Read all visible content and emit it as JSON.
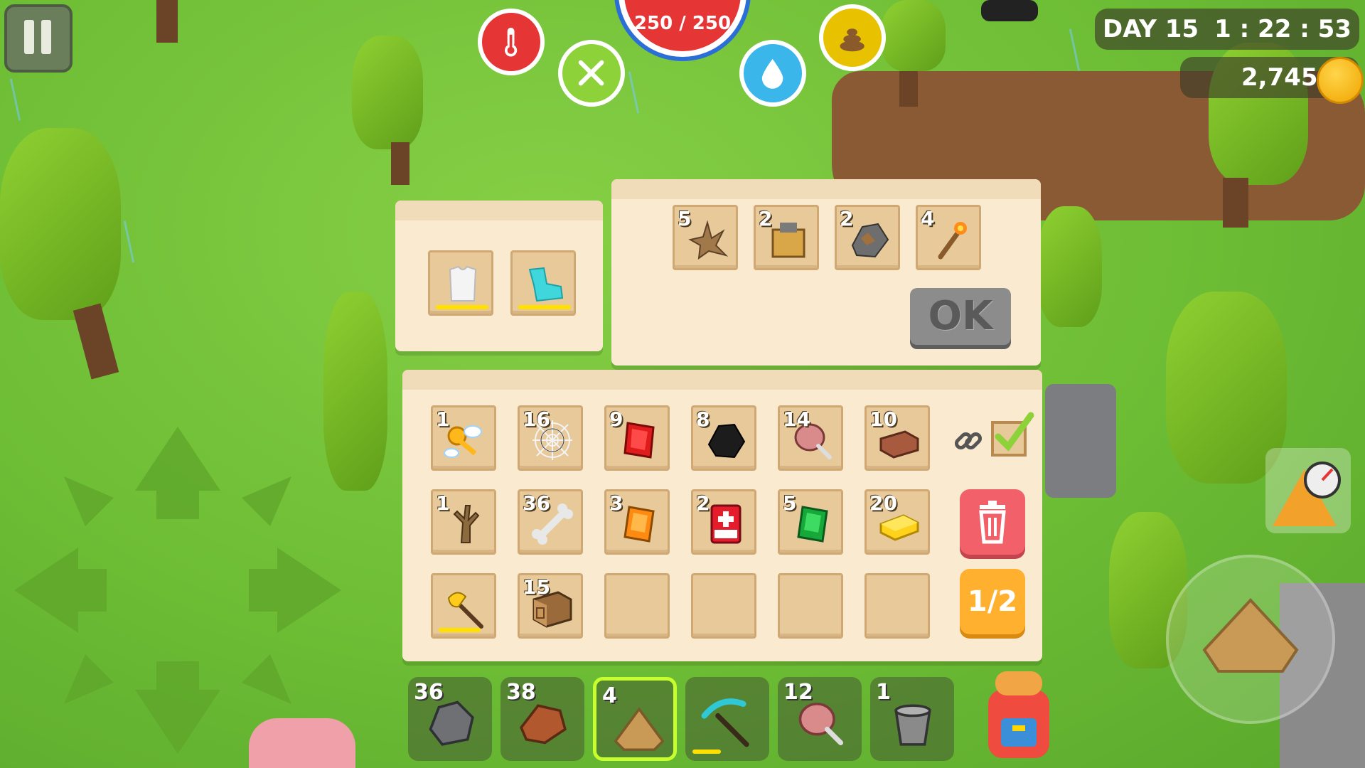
{
  "hud": {
    "health": "250 / 250",
    "day_label": "DAY 15",
    "clock": "1 : 22 : 53",
    "coins": "2,745",
    "stats": [
      "temperature-icon",
      "hunger-icon",
      "thirst-icon",
      "toilet-icon"
    ]
  },
  "equipment": {
    "slots": [
      {
        "icon": "shirt-icon",
        "durability": 0.85
      },
      {
        "icon": "boots-icon",
        "durability": 0.85
      }
    ]
  },
  "crafting": {
    "ingredients": [
      {
        "count": "5",
        "icon": "roots-icon"
      },
      {
        "count": "2",
        "icon": "furnace-crate-icon"
      },
      {
        "count": "2",
        "icon": "iron-ore-icon"
      },
      {
        "count": "4",
        "icon": "torch-icon"
      }
    ],
    "ok_label": "OK"
  },
  "inventory": {
    "page": "1/2",
    "rows": [
      [
        {
          "count": "1",
          "icon": "winged-key-icon"
        },
        {
          "count": "16",
          "icon": "spider-web-icon"
        },
        {
          "count": "9",
          "icon": "ruby-icon"
        },
        {
          "count": "8",
          "icon": "coal-icon"
        },
        {
          "count": "14",
          "icon": "meat-icon"
        },
        {
          "count": "10",
          "icon": "clay-brick-icon"
        }
      ],
      [
        {
          "count": "1",
          "icon": "dead-tree-icon"
        },
        {
          "count": "36",
          "icon": "bone-icon"
        },
        {
          "count": "3",
          "icon": "amber-icon"
        },
        {
          "count": "2",
          "icon": "medkit-icon"
        },
        {
          "count": "5",
          "icon": "emerald-icon"
        },
        {
          "count": "20",
          "icon": "gold-bar-icon"
        }
      ],
      [
        {
          "count": "",
          "icon": "axe-icon",
          "durability": 0.8
        },
        {
          "count": "15",
          "icon": "wood-log-icon"
        },
        {
          "count": "",
          "icon": ""
        },
        {
          "count": "",
          "icon": ""
        },
        {
          "count": "",
          "icon": ""
        },
        {
          "count": "",
          "icon": ""
        }
      ]
    ]
  },
  "hotbar": [
    {
      "count": "36",
      "icon": "stone-icon"
    },
    {
      "count": "38",
      "icon": "copper-ore-icon"
    },
    {
      "count": "4",
      "icon": "sand-pile-icon",
      "selected": true
    },
    {
      "count": "",
      "icon": "pickaxe-icon",
      "durability": 0.4
    },
    {
      "count": "12",
      "icon": "meat-icon"
    },
    {
      "count": "1",
      "icon": "bucket-icon"
    }
  ],
  "colors": {
    "grass": "#6fbf3a",
    "panel": "#faebd0",
    "slot": "#e8c99a",
    "health": "#e53535",
    "select": "#c6ff2e"
  }
}
